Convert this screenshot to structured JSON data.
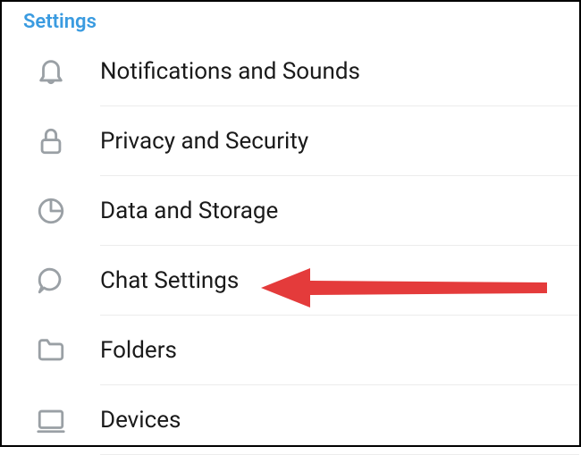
{
  "header": {
    "title": "Settings"
  },
  "items": [
    {
      "label": "Notifications and Sounds",
      "icon": "bell-icon"
    },
    {
      "label": "Privacy and Security",
      "icon": "lock-icon"
    },
    {
      "label": "Data and Storage",
      "icon": "pie-chart-icon"
    },
    {
      "label": "Chat Settings",
      "icon": "chat-bubble-icon"
    },
    {
      "label": "Folders",
      "icon": "folder-icon"
    },
    {
      "label": "Devices",
      "icon": "device-icon"
    }
  ],
  "annotation": {
    "type": "arrow",
    "color": "#e43b3b",
    "points_to_item_index": 3
  }
}
